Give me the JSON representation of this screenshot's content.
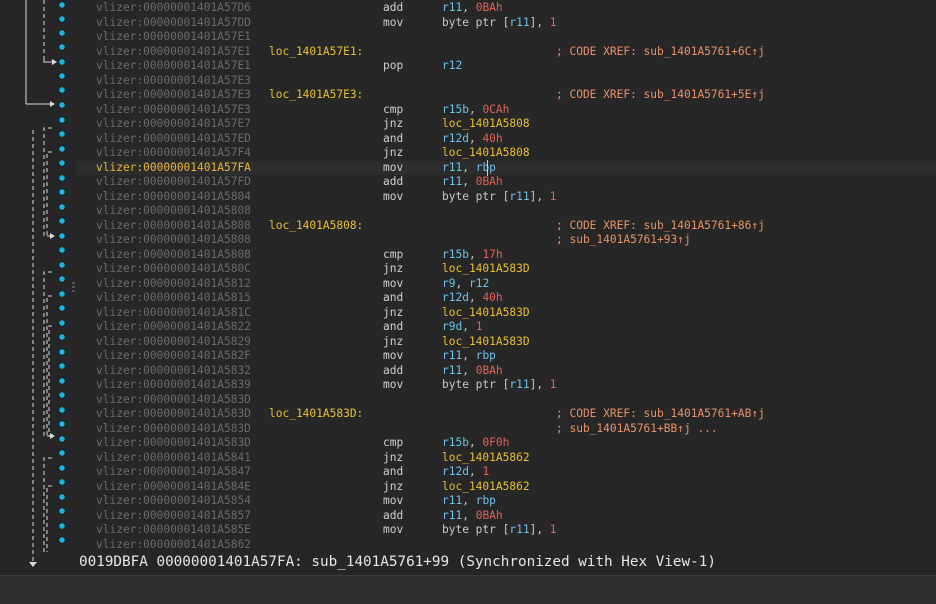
{
  "listing": {
    "rows": [
      {
        "addr": "vlizer:00000001401A57D6",
        "label": "",
        "mnem": "add",
        "ops": [
          [
            "r11",
            "reg"
          ],
          [
            ", ",
            "plain"
          ],
          [
            "0BAh",
            "num"
          ]
        ],
        "comment": ""
      },
      {
        "addr": "vlizer:00000001401A57DD",
        "label": "",
        "mnem": "mov",
        "ops": [
          [
            "byte ptr [",
            "plain"
          ],
          [
            "r11",
            "reg"
          ],
          [
            "], ",
            "plain"
          ],
          [
            "1",
            "num"
          ]
        ],
        "comment": ""
      },
      {
        "addr": "vlizer:00000001401A57E1",
        "label": "",
        "mnem": "",
        "ops": [],
        "comment": ""
      },
      {
        "addr": "vlizer:00000001401A57E1",
        "label": "loc_1401A57E1:",
        "mnem": "",
        "ops": [],
        "comment": "; CODE XREF: sub_1401A5761+6C↑j"
      },
      {
        "addr": "vlizer:00000001401A57E1",
        "label": "",
        "mnem": "pop",
        "ops": [
          [
            "r12",
            "reg"
          ]
        ],
        "comment": ""
      },
      {
        "addr": "vlizer:00000001401A57E3",
        "label": "",
        "mnem": "",
        "ops": [],
        "comment": ""
      },
      {
        "addr": "vlizer:00000001401A57E3",
        "label": "loc_1401A57E3:",
        "mnem": "",
        "ops": [],
        "comment": "; CODE XREF: sub_1401A5761+5E↑j"
      },
      {
        "addr": "vlizer:00000001401A57E3",
        "label": "",
        "mnem": "cmp",
        "ops": [
          [
            "r15b",
            "reg"
          ],
          [
            ", ",
            "plain"
          ],
          [
            "0CAh",
            "num"
          ]
        ],
        "comment": ""
      },
      {
        "addr": "vlizer:00000001401A57E7",
        "label": "",
        "mnem": "jnz",
        "ops": [
          [
            "loc_1401A5808",
            "lbl"
          ]
        ],
        "comment": ""
      },
      {
        "addr": "vlizer:00000001401A57ED",
        "label": "",
        "mnem": "and",
        "ops": [
          [
            "r12d",
            "reg"
          ],
          [
            ", ",
            "plain"
          ],
          [
            "40h",
            "num"
          ]
        ],
        "comment": ""
      },
      {
        "addr": "vlizer:00000001401A57F4",
        "label": "",
        "mnem": "jnz",
        "ops": [
          [
            "loc_1401A5808",
            "lbl"
          ]
        ],
        "comment": ""
      },
      {
        "addr": "vlizer:00000001401A57FA",
        "label": "",
        "mnem": "mov",
        "ops": [
          [
            "r11",
            "reg"
          ],
          [
            ", ",
            "plain"
          ],
          [
            "rbp",
            "reg"
          ]
        ],
        "comment": "",
        "current": true
      },
      {
        "addr": "vlizer:00000001401A57FD",
        "label": "",
        "mnem": "add",
        "ops": [
          [
            "r11",
            "reg"
          ],
          [
            ", ",
            "plain"
          ],
          [
            "0BAh",
            "num"
          ]
        ],
        "comment": ""
      },
      {
        "addr": "vlizer:00000001401A5804",
        "label": "",
        "mnem": "mov",
        "ops": [
          [
            "byte ptr [",
            "plain"
          ],
          [
            "r11",
            "reg"
          ],
          [
            "], ",
            "plain"
          ],
          [
            "1",
            "num"
          ]
        ],
        "comment": ""
      },
      {
        "addr": "vlizer:00000001401A5808",
        "label": "",
        "mnem": "",
        "ops": [],
        "comment": ""
      },
      {
        "addr": "vlizer:00000001401A5808",
        "label": "loc_1401A5808:",
        "mnem": "",
        "ops": [],
        "comment": "; CODE XREF: sub_1401A5761+86↑j"
      },
      {
        "addr": "vlizer:00000001401A5808",
        "label": "",
        "mnem": "",
        "ops": [],
        "comment": "; sub_1401A5761+93↑j"
      },
      {
        "addr": "vlizer:00000001401A5808",
        "label": "",
        "mnem": "cmp",
        "ops": [
          [
            "r15b",
            "reg"
          ],
          [
            ", ",
            "plain"
          ],
          [
            "17h",
            "num"
          ]
        ],
        "comment": ""
      },
      {
        "addr": "vlizer:00000001401A580C",
        "label": "",
        "mnem": "jnz",
        "ops": [
          [
            "loc_1401A583D",
            "lbl"
          ]
        ],
        "comment": ""
      },
      {
        "addr": "vlizer:00000001401A5812",
        "label": "",
        "mnem": "mov",
        "ops": [
          [
            "r9",
            "reg"
          ],
          [
            ", ",
            "plain"
          ],
          [
            "r12",
            "reg"
          ]
        ],
        "comment": ""
      },
      {
        "addr": "vlizer:00000001401A5815",
        "label": "",
        "mnem": "and",
        "ops": [
          [
            "r12d",
            "reg"
          ],
          [
            ", ",
            "plain"
          ],
          [
            "40h",
            "num"
          ]
        ],
        "comment": ""
      },
      {
        "addr": "vlizer:00000001401A581C",
        "label": "",
        "mnem": "jnz",
        "ops": [
          [
            "loc_1401A583D",
            "lbl"
          ]
        ],
        "comment": ""
      },
      {
        "addr": "vlizer:00000001401A5822",
        "label": "",
        "mnem": "and",
        "ops": [
          [
            "r9d",
            "reg"
          ],
          [
            ", ",
            "plain"
          ],
          [
            "1",
            "num"
          ]
        ],
        "comment": ""
      },
      {
        "addr": "vlizer:00000001401A5829",
        "label": "",
        "mnem": "jnz",
        "ops": [
          [
            "loc_1401A583D",
            "lbl"
          ]
        ],
        "comment": ""
      },
      {
        "addr": "vlizer:00000001401A582F",
        "label": "",
        "mnem": "mov",
        "ops": [
          [
            "r11",
            "reg"
          ],
          [
            ", ",
            "plain"
          ],
          [
            "rbp",
            "reg"
          ]
        ],
        "comment": ""
      },
      {
        "addr": "vlizer:00000001401A5832",
        "label": "",
        "mnem": "add",
        "ops": [
          [
            "r11",
            "reg"
          ],
          [
            ", ",
            "plain"
          ],
          [
            "0BAh",
            "num"
          ]
        ],
        "comment": ""
      },
      {
        "addr": "vlizer:00000001401A5839",
        "label": "",
        "mnem": "mov",
        "ops": [
          [
            "byte ptr [",
            "plain"
          ],
          [
            "r11",
            "reg"
          ],
          [
            "], ",
            "plain"
          ],
          [
            "1",
            "num"
          ]
        ],
        "comment": ""
      },
      {
        "addr": "vlizer:00000001401A583D",
        "label": "",
        "mnem": "",
        "ops": [],
        "comment": ""
      },
      {
        "addr": "vlizer:00000001401A583D",
        "label": "loc_1401A583D:",
        "mnem": "",
        "ops": [],
        "comment": "; CODE XREF: sub_1401A5761+AB↑j"
      },
      {
        "addr": "vlizer:00000001401A583D",
        "label": "",
        "mnem": "",
        "ops": [],
        "comment": "; sub_1401A5761+BB↑j ..."
      },
      {
        "addr": "vlizer:00000001401A583D",
        "label": "",
        "mnem": "cmp",
        "ops": [
          [
            "r15b",
            "reg"
          ],
          [
            ", ",
            "plain"
          ],
          [
            "0F0h",
            "num"
          ]
        ],
        "comment": ""
      },
      {
        "addr": "vlizer:00000001401A5841",
        "label": "",
        "mnem": "jnz",
        "ops": [
          [
            "loc_1401A5862",
            "lbl"
          ]
        ],
        "comment": ""
      },
      {
        "addr": "vlizer:00000001401A5847",
        "label": "",
        "mnem": "and",
        "ops": [
          [
            "r12d",
            "reg"
          ],
          [
            ", ",
            "plain"
          ],
          [
            "1",
            "num"
          ]
        ],
        "comment": ""
      },
      {
        "addr": "vlizer:00000001401A584E",
        "label": "",
        "mnem": "jnz",
        "ops": [
          [
            "loc_1401A5862",
            "lbl"
          ]
        ],
        "comment": ""
      },
      {
        "addr": "vlizer:00000001401A5854",
        "label": "",
        "mnem": "mov",
        "ops": [
          [
            "r11",
            "reg"
          ],
          [
            ", ",
            "plain"
          ],
          [
            "rbp",
            "reg"
          ]
        ],
        "comment": ""
      },
      {
        "addr": "vlizer:00000001401A5857",
        "label": "",
        "mnem": "add",
        "ops": [
          [
            "r11",
            "reg"
          ],
          [
            ", ",
            "plain"
          ],
          [
            "0BAh",
            "num"
          ]
        ],
        "comment": ""
      },
      {
        "addr": "vlizer:00000001401A585E",
        "label": "",
        "mnem": "mov",
        "ops": [
          [
            "byte ptr [",
            "plain"
          ],
          [
            "r11",
            "reg"
          ],
          [
            "], ",
            "plain"
          ],
          [
            "1",
            "num"
          ]
        ],
        "comment": ""
      },
      {
        "addr": "vlizer:00000001401A5862",
        "label": "",
        "mnem": "",
        "ops": [],
        "comment": ""
      }
    ]
  },
  "status": {
    "text": "0019DBFA 00000001401A57FA: sub_1401A5761+99 (Synchronized with Hex View-1)"
  },
  "colors": {
    "background": "#272727",
    "address": "#6a6a6a",
    "current_address": "#e6b73a",
    "label": "#e6c02f",
    "register": "#6fc0e6",
    "number": "#e0625a",
    "comment": "#e7916a",
    "arrow_dot": "#19b8e8"
  },
  "icons": {
    "gutter_arrow": "arrow-right-icon",
    "breakpoint_dot": "dot-icon"
  }
}
